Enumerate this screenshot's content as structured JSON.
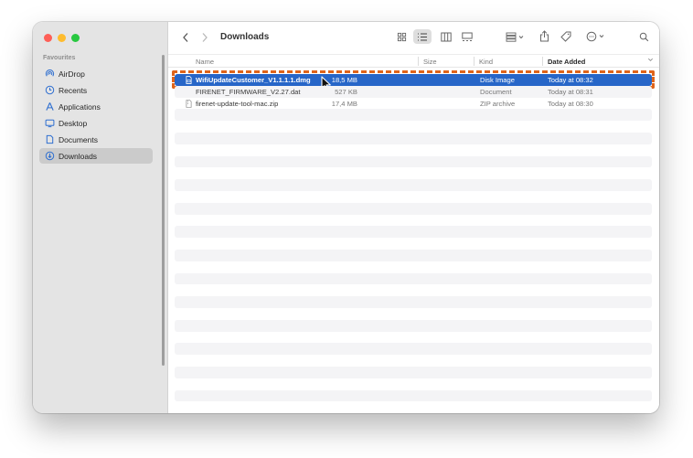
{
  "window": {
    "title": "Downloads"
  },
  "sidebar": {
    "heading": "Favourites",
    "items": [
      {
        "label": "AirDrop",
        "icon": "airdrop-icon"
      },
      {
        "label": "Recents",
        "icon": "clock-icon"
      },
      {
        "label": "Applications",
        "icon": "applications-icon"
      },
      {
        "label": "Desktop",
        "icon": "desktop-icon"
      },
      {
        "label": "Documents",
        "icon": "document-icon"
      },
      {
        "label": "Downloads",
        "icon": "download-icon",
        "selected": true
      }
    ]
  },
  "columns": {
    "name": "Name",
    "size": "Size",
    "kind": "Kind",
    "date": "Date Added"
  },
  "files": [
    {
      "name": "WifiUpdateCustomer_V1.1.1.1.dmg",
      "size": "18,5 MB",
      "kind": "Disk Image",
      "date": "Today at 08:32",
      "selected": true
    },
    {
      "name": "FIRENET_FIRMWARE_V2.27.dat",
      "size": "527 KB",
      "kind": "Document",
      "date": "Today at 08:31"
    },
    {
      "name": "firenet-update-tool-mac.zip",
      "size": "17,4 MB",
      "kind": "ZIP archive",
      "date": "Today at 08:30"
    }
  ],
  "colors": {
    "selection": "#2766c8",
    "highlight_border": "#e0641a",
    "sidebar_bg": "#e4e4e4"
  },
  "toolbar_icons": [
    "back-icon",
    "forward-icon",
    "icon-view-icon",
    "list-view-icon",
    "column-view-icon",
    "gallery-view-icon",
    "group-icon",
    "share-icon",
    "tag-icon",
    "more-icon",
    "search-icon"
  ]
}
